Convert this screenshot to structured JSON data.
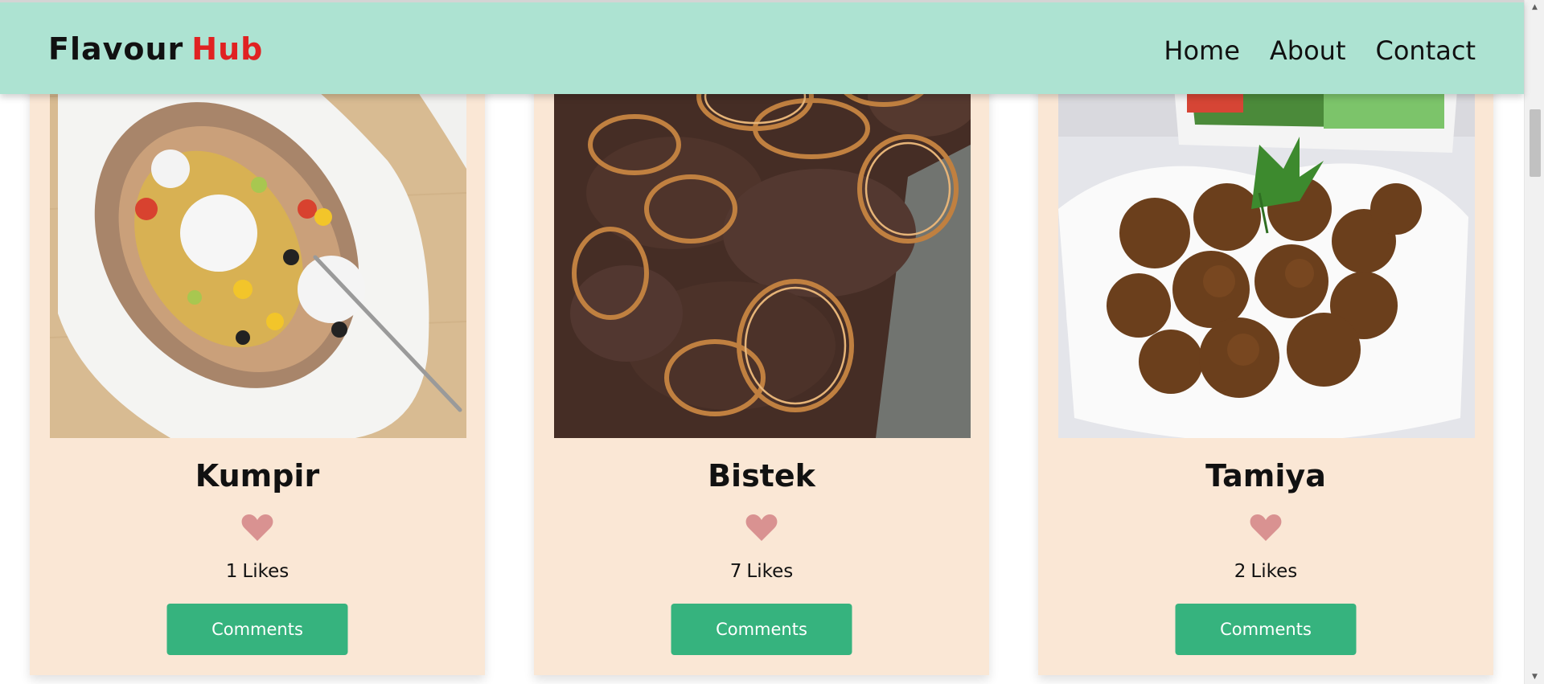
{
  "header": {
    "logo_text": "Flavour",
    "logo_accent": "Hub",
    "nav": [
      {
        "label": "Home"
      },
      {
        "label": "About"
      },
      {
        "label": "Contact"
      }
    ]
  },
  "cards": [
    {
      "title": "Kumpir",
      "likes": "1",
      "likes_suffix": "Likes",
      "button": "Comments",
      "image": "kumpir-photo"
    },
    {
      "title": "Bistek",
      "likes": "7",
      "likes_suffix": "Likes",
      "button": "Comments",
      "image": "bistek-photo"
    },
    {
      "title": "Tamiya",
      "likes": "2",
      "likes_suffix": "Likes",
      "button": "Comments",
      "image": "tamiya-photo"
    }
  ],
  "colors": {
    "header_bg": "#ade3d2",
    "card_bg": "#fae7d5",
    "accent_red": "#e02222",
    "button_green": "#36b37e",
    "heart": "#d99291"
  },
  "icons": {
    "like": "heart-icon",
    "scroll_up": "scroll-up-arrow-icon",
    "scroll_down": "scroll-down-arrow-icon"
  }
}
